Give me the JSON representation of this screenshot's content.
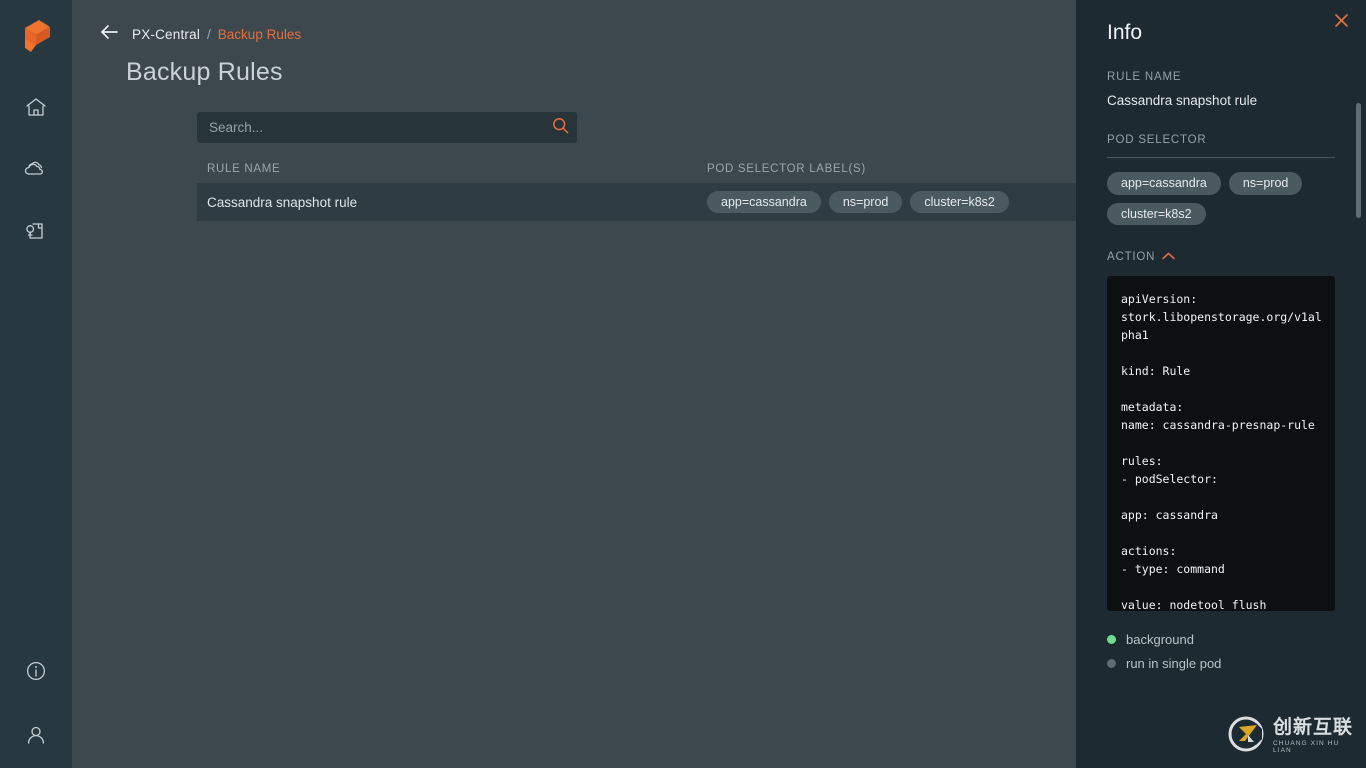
{
  "rail": {
    "logo": "portworx-logo",
    "nav": [
      {
        "icon": "home-icon",
        "name": "home"
      },
      {
        "icon": "clouds-icon",
        "name": "clusters"
      },
      {
        "icon": "backup-document-icon",
        "name": "backup"
      }
    ],
    "bottom": [
      {
        "icon": "info-circle-icon",
        "name": "info"
      },
      {
        "icon": "user-icon",
        "name": "account"
      }
    ]
  },
  "header": {
    "back_icon": "arrow-left-icon",
    "breadcrumb_root": "PX-Central",
    "breadcrumb_sep": "/",
    "breadcrumb_current": "Backup Rules",
    "page_title": "Backup Rules"
  },
  "search": {
    "placeholder": "Search...",
    "value": "",
    "icon": "search-icon"
  },
  "table": {
    "columns": [
      "RULE NAME",
      "POD SELECTOR LABEL(S)"
    ],
    "rows": [
      {
        "rule_name": "Cassandra snapshot rule",
        "labels": [
          "app=cassandra",
          "ns=prod",
          "cluster=k8s2"
        ]
      }
    ]
  },
  "panel": {
    "title": "Info",
    "close_icon": "close-icon",
    "rule_name_label": "RULE NAME",
    "rule_name_value": "Cassandra snapshot rule",
    "pod_selector_label": "POD SELECTOR",
    "pod_selector_chips": [
      "app=cassandra",
      "ns=prod",
      "cluster=k8s2"
    ],
    "action_label": "ACTION",
    "action_chevron_icon": "chevron-up-icon",
    "action_yaml": "apiVersion: stork.libopenstorage.org/v1alpha1\n\nkind: Rule\n\nmetadata:\nname: cassandra-presnap-rule\n\nrules:\n- podSelector:\n\napp: cassandra\n\nactions:\n- type: command\n\nvalue: nodetool flush",
    "statuses": [
      {
        "text": "background",
        "state": "on",
        "color": "#6fdc8c"
      },
      {
        "text": "run in single pod",
        "state": "off",
        "color": "#5d6b72"
      }
    ]
  },
  "watermark": {
    "cn": "创新互联",
    "en": "CHUANG XIN HU LIAN",
    "icon": "cx-logo-icon"
  },
  "colors": {
    "accent": "#e8703a",
    "rail_bg": "#283840",
    "main_bg": "#3c484e",
    "panel_bg": "#1d2a31",
    "row_bg": "#2f3c43",
    "chip_bg": "#4b5a61",
    "code_bg": "#0d0f11"
  }
}
